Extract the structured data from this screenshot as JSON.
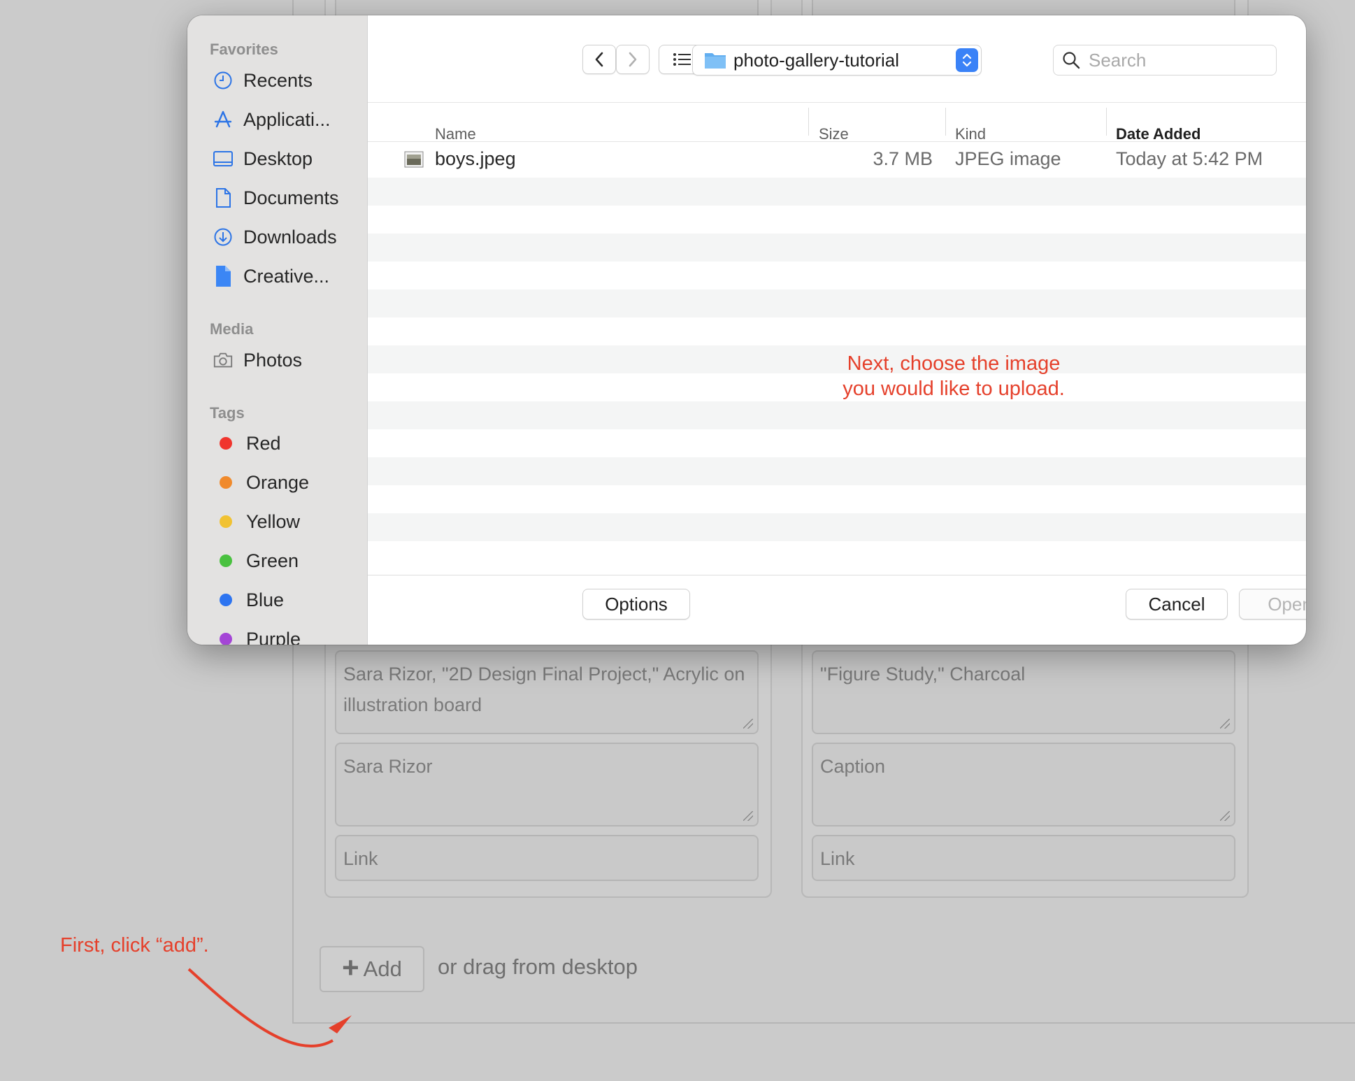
{
  "background": {
    "cards": [
      {
        "title_field": "Sara Rizor, \"2D Design Final Project,\" Acrylic on illustration board",
        "caption_field": "Sara Rizor",
        "link_placeholder": "Link"
      },
      {
        "title_field": "\"Figure Study,\" Charcoal",
        "caption_placeholder": "Caption",
        "link_placeholder": "Link"
      }
    ],
    "add_button_label": "Add",
    "drag_text": "or drag from desktop"
  },
  "annotations": {
    "first": "First, click “add”.",
    "next_line1": "Next, choose the image",
    "next_line2": "you would like to upload.",
    "color": "#e5402b"
  },
  "dialog": {
    "sidebar": {
      "favorites_heading": "Favorites",
      "favorites": [
        {
          "label": "Recents",
          "icon": "clock-icon"
        },
        {
          "label": "Applicati...",
          "icon": "applications-icon"
        },
        {
          "label": "Desktop",
          "icon": "desktop-icon"
        },
        {
          "label": "Documents",
          "icon": "document-icon"
        },
        {
          "label": "Downloads",
          "icon": "download-icon"
        },
        {
          "label": "Creative...",
          "icon": "file-icon"
        }
      ],
      "media_heading": "Media",
      "media": [
        {
          "label": "Photos",
          "icon": "camera-icon"
        }
      ],
      "tags_heading": "Tags",
      "tags": [
        {
          "label": "Red",
          "color": "#f0352d"
        },
        {
          "label": "Orange",
          "color": "#f08a2c"
        },
        {
          "label": "Yellow",
          "color": "#f1c232"
        },
        {
          "label": "Green",
          "color": "#49c13f"
        },
        {
          "label": "Blue",
          "color": "#2d74f0"
        },
        {
          "label": "Purple",
          "color": "#a445d6"
        }
      ]
    },
    "toolbar": {
      "current_folder": "photo-gallery-tutorial",
      "search_placeholder": "Search"
    },
    "columns": {
      "name": "Name",
      "size": "Size",
      "kind": "Kind",
      "date_added": "Date Added"
    },
    "files": [
      {
        "name": "boys.jpeg",
        "size": "3.7 MB",
        "kind": "JPEG image",
        "date_added": "Today at 5:42 PM"
      }
    ],
    "footer": {
      "options": "Options",
      "cancel": "Cancel",
      "open": "Open"
    }
  }
}
